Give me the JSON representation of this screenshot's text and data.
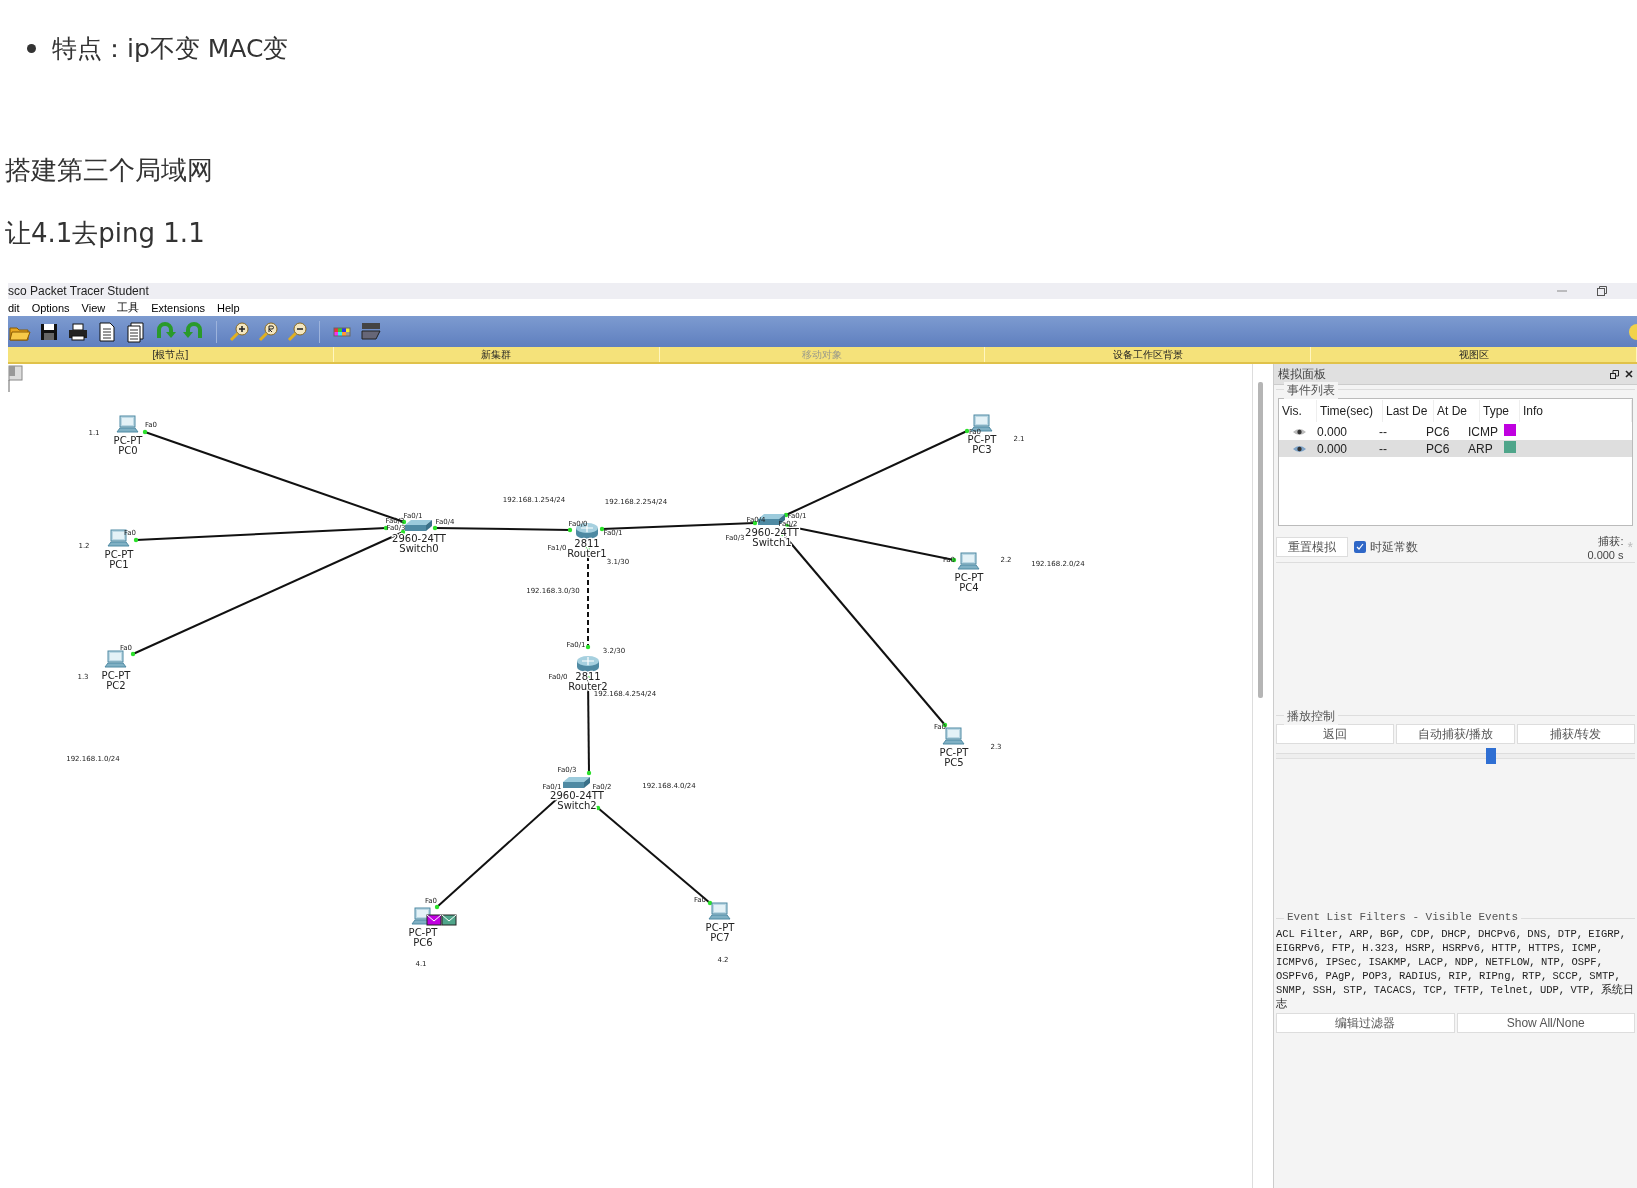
{
  "article": {
    "bullets": [
      "特点：ip不变 MAC变"
    ],
    "heading": "搭建第三个局域网",
    "paragraph": "让4.1去ping 1.1"
  },
  "window": {
    "title": "sco Packet Tracer Student"
  },
  "menu": [
    "dit",
    "Options",
    "View",
    "工具",
    "Extensions",
    "Help"
  ],
  "workspace_bar": [
    {
      "label": "[根节点]",
      "disabled": false
    },
    {
      "label": "新集群",
      "disabled": false
    },
    {
      "label": "移动对象",
      "disabled": true
    },
    {
      "label": "设备工作区背景",
      "disabled": false
    },
    {
      "label": "视图区",
      "disabled": false
    }
  ],
  "devices": [
    {
      "kind": "pc",
      "model": "PC-PT",
      "name": "PC0",
      "ports": [
        "Fa0"
      ]
    },
    {
      "kind": "pc",
      "model": "PC-PT",
      "name": "PC1",
      "ports": [
        "Fa0"
      ]
    },
    {
      "kind": "pc",
      "model": "PC-PT",
      "name": "PC2",
      "ports": [
        "Fa0"
      ]
    },
    {
      "kind": "switch",
      "model": "2960-24TT",
      "name": "Switch0",
      "ports": [
        "Fa0/1",
        "Fa0/2",
        "Fa0/3",
        "Fa0/4"
      ]
    },
    {
      "kind": "router",
      "model": "2811",
      "name": "Router1",
      "ports": [
        "Fa0/0",
        "Fa0/1",
        "Fa1/0"
      ]
    },
    {
      "kind": "router",
      "model": "2811",
      "name": "Router2",
      "ports": [
        "Fa0/1",
        "Fa0/0"
      ]
    },
    {
      "kind": "switch",
      "model": "2960-24TT",
      "name": "Switch2",
      "ports": [
        "Fa0/3",
        "Fa0/1",
        "Fa0/2"
      ]
    },
    {
      "kind": "pc",
      "model": "PC-PT",
      "name": "PC6",
      "ports": [
        "Fa0"
      ],
      "packets": [
        {
          "color": "#c000e0"
        },
        {
          "color": "#4fa58a"
        }
      ]
    },
    {
      "kind": "pc",
      "model": "PC-PT",
      "name": "PC7",
      "ports": [
        "Fa0"
      ]
    },
    {
      "kind": "switch",
      "model": "2960-24TT",
      "name": "Switch1",
      "ports": [
        "Fa0/1",
        "Fa0/4",
        "Fa0/2",
        "Fa0/3"
      ]
    },
    {
      "kind": "pc",
      "model": "PC-PT",
      "name": "PC3",
      "ports": [
        "Fa0"
      ]
    },
    {
      "kind": "pc",
      "model": "PC-PT",
      "name": "PC4",
      "ports": [
        "Fa0"
      ]
    },
    {
      "kind": "pc",
      "model": "PC-PT",
      "name": "PC5",
      "ports": [
        "Fa0"
      ]
    }
  ],
  "links": [
    {
      "kind": "straight"
    },
    {
      "kind": "straight"
    },
    {
      "kind": "straight"
    },
    {
      "kind": "straight"
    },
    {
      "kind": "straight"
    },
    {
      "kind": "straight"
    },
    {
      "kind": "straight"
    },
    {
      "kind": "straight"
    },
    {
      "kind": "crossover"
    },
    {
      "kind": "straight"
    },
    {
      "kind": "straight"
    },
    {
      "kind": "straight"
    }
  ],
  "notes": [
    "1.1",
    "1.2",
    "1.3",
    "192.168.1.0/24",
    "192.168.1.254/24",
    "192.168.2.254/24",
    "3.1/30",
    "192.168.3.0/30",
    "3.2/30",
    "192.168.4.254/24",
    "192.168.4.0/24",
    "4.1",
    "4.2",
    "2.1",
    "2.2",
    "192.168.2.0/24",
    "2.3"
  ],
  "simulation_panel": {
    "title": "模拟面板",
    "event_list": {
      "title": "事件列表",
      "columns": [
        "Vis.",
        "Time(sec)",
        "Last De",
        "At De",
        "Type",
        "Info"
      ],
      "rows": [
        {
          "time": "0.000",
          "last_device": "--",
          "at_device": "PC6",
          "type": "ICMP",
          "color": "#c000e0",
          "selected": false
        },
        {
          "time": "0.000",
          "last_device": "--",
          "at_device": "PC6",
          "type": "ARP",
          "color": "#4fa58a",
          "selected": true
        }
      ]
    },
    "reset_button": "重置模拟",
    "constant_delay": {
      "label": "时延常数",
      "checked": true
    },
    "capture_label": "捕获:",
    "capture_time": "0.000 s",
    "capture_mark": "*",
    "play_controls": {
      "title": "播放控制",
      "buttons": [
        "返回",
        "自动捕获/播放",
        "捕获/转发"
      ],
      "level": 0.6
    },
    "filters": {
      "title": "Event List Filters - Visible Events",
      "text": "ACL Filter, ARP, BGP, CDP, DHCP, DHCPv6, DNS, DTP, EIGRP, EIGRPv6, FTP, H.323, HSRP, HSRPv6, HTTP, HTTPS, ICMP, ICMPv6, IPSec, ISAKMP, LACP, NDP, NETFLOW, NTP, OSPF, OSPFv6, PAgP, POP3, RADIUS, RIP, RIPng, RTP, SCCP, SMTP, SNMP, SSH, STP, TACACS, TCP, TFTP, Telnet, UDP, VTP, 系统日志",
      "buttons": [
        "编辑过滤器",
        "Show All/None"
      ]
    }
  }
}
